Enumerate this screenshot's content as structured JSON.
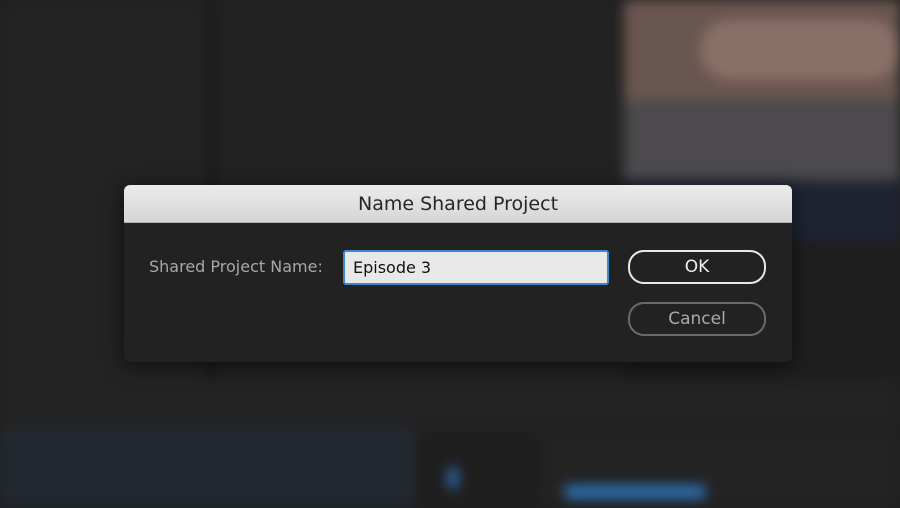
{
  "dialog": {
    "title": "Name Shared Project",
    "field_label": "Shared Project Name:",
    "field_value": "Episode 3",
    "ok_label": "OK",
    "cancel_label": "Cancel"
  },
  "colors": {
    "accent": "#3f86d2",
    "background": "#1f1f1f"
  }
}
